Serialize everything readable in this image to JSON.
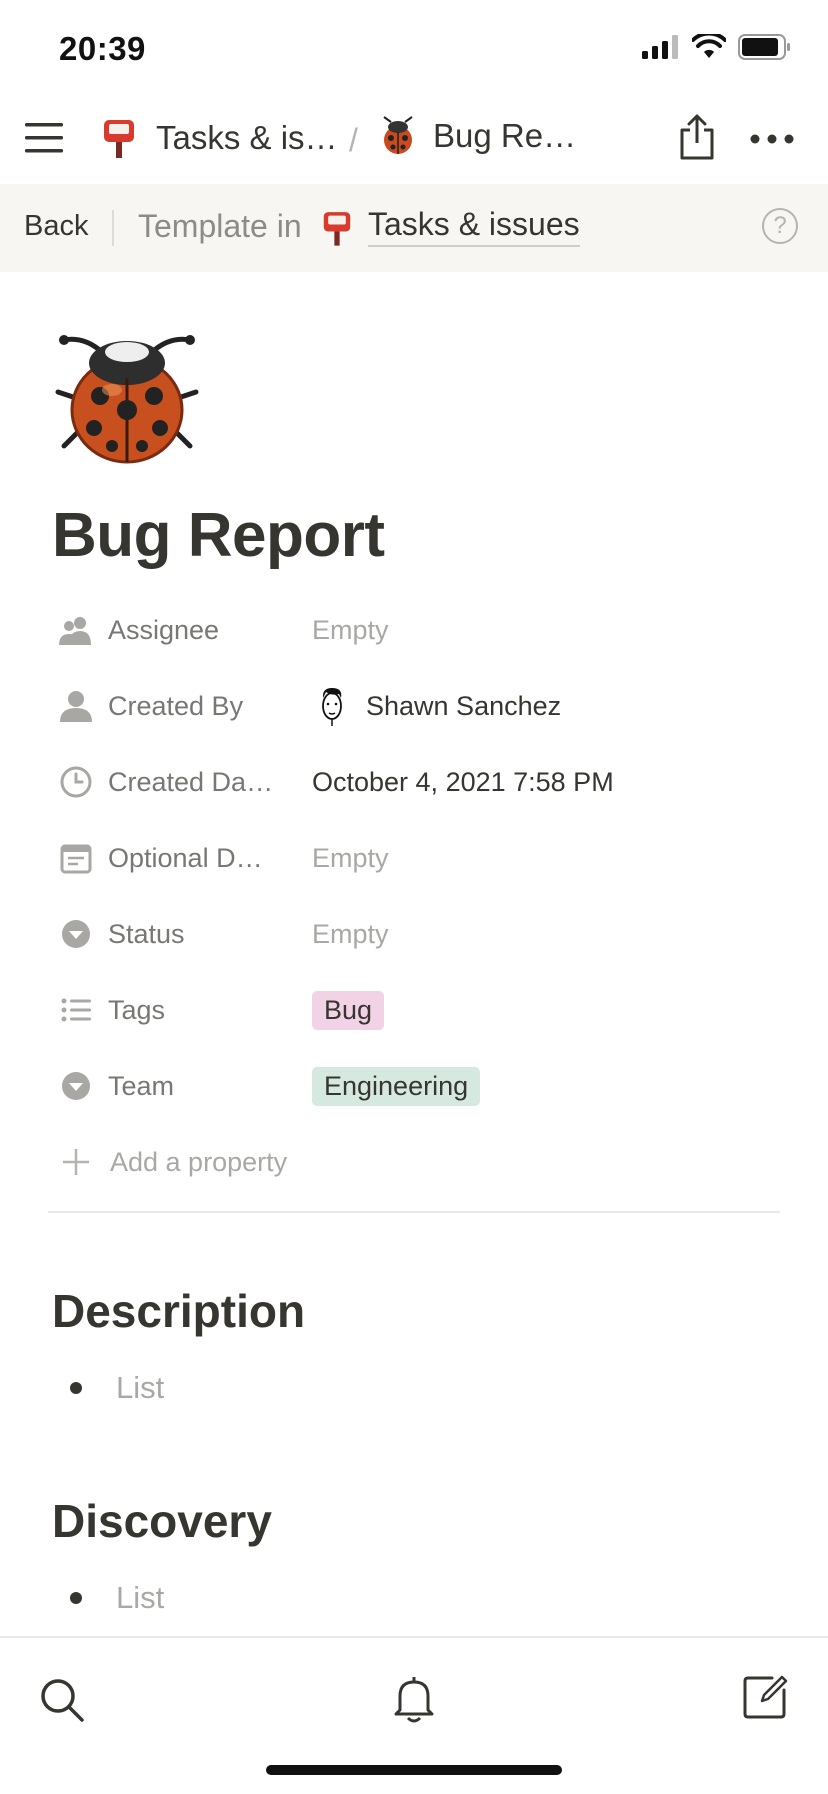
{
  "status_bar": {
    "time": "20:39"
  },
  "navbar": {
    "breadcrumb_1": "Tasks & is…",
    "separator": "/",
    "breadcrumb_2": "Bug Re…"
  },
  "banner": {
    "back_label": "Back",
    "template_label": "Template in",
    "database_link": "Tasks & issues",
    "help_glyph": "?"
  },
  "page": {
    "title": "Bug Report",
    "properties": [
      {
        "name": "Assignee",
        "value": "Empty",
        "icon": "people-icon"
      },
      {
        "name": "Created By",
        "value": "Shawn Sanchez",
        "icon": "person-icon"
      },
      {
        "name": "Created Da…",
        "value": "October 4, 2021 7:58 PM",
        "icon": "clock-icon"
      },
      {
        "name": "Optional D…",
        "value": "Empty",
        "icon": "calendar-icon"
      },
      {
        "name": "Status",
        "value": "Empty",
        "icon": "select-icon"
      },
      {
        "name": "Tags",
        "value": "Bug",
        "icon": "list-icon",
        "tag_color": "#f2d3e6"
      },
      {
        "name": "Team",
        "value": "Engineering",
        "icon": "select-icon",
        "tag_color": "#d6e9e1"
      }
    ],
    "add_property": "Add a property",
    "sections": [
      {
        "heading": "Description",
        "bullet": "List"
      },
      {
        "heading": "Discovery",
        "bullet": "List"
      }
    ]
  },
  "colors": {
    "banner_bg": "#f7f6f3",
    "text": "#37352f",
    "muted": "#787774",
    "placeholder": "#a9a8a4"
  }
}
